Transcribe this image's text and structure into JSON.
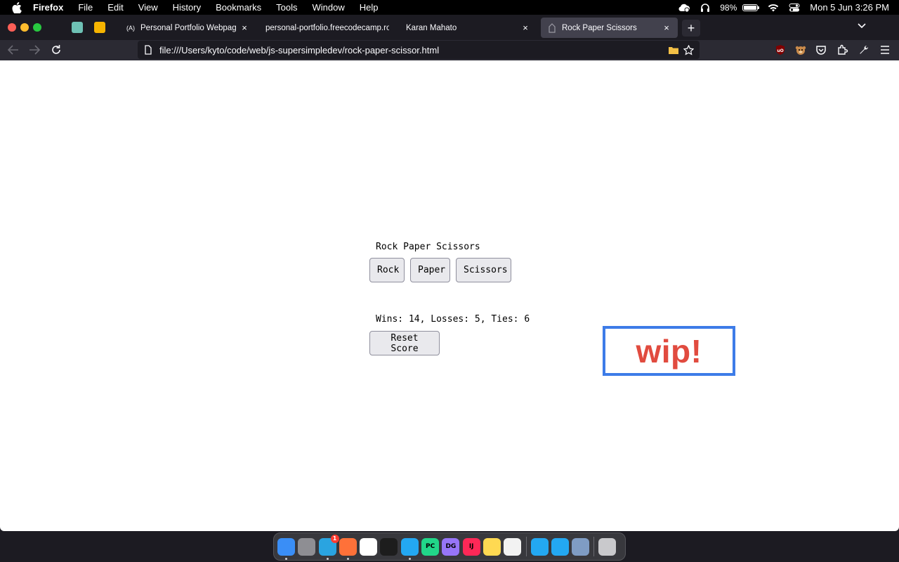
{
  "menubar": {
    "app_name": "Firefox",
    "menus": [
      "File",
      "Edit",
      "View",
      "History",
      "Bookmarks",
      "Tools",
      "Window",
      "Help"
    ],
    "battery_percent": "98%",
    "battery_level": 0.98,
    "clock": "Mon 5 Jun  3:26 PM"
  },
  "tabs": [
    {
      "title": "Personal Portfolio Webpage: Bu",
      "favicon": "(A)",
      "active": false
    },
    {
      "title": "personal-portfolio.freecodecamp.ro",
      "favicon": "",
      "active": false
    },
    {
      "title": "Karan Mahato",
      "favicon": "",
      "active": false
    },
    {
      "title": "Rock Paper Scissors",
      "favicon": "",
      "active": true
    }
  ],
  "tab_close": "×",
  "newtab_label": "+",
  "navbar": {
    "url": "file:///Users/kyto/code/web/js-supersimpledev/rock-paper-scissor.html"
  },
  "game": {
    "title": "Rock Paper Scissors",
    "moves": [
      "Rock",
      "Paper",
      "Scissors"
    ],
    "score_text": "Wins: 14, Losses: 5, Ties: 6",
    "reset_label": "Reset Score"
  },
  "overlay": {
    "label": "wip!",
    "border_color": "#3d7ce8",
    "text_color": "#e14b3f"
  },
  "dock": {
    "apps": [
      {
        "name": "finder",
        "color": "#3a8ef6"
      },
      {
        "name": "launchpad",
        "color": "#8e8e93"
      },
      {
        "name": "telegram",
        "color": "#2aa4e0",
        "badge": "1"
      },
      {
        "name": "firefox",
        "color": "#ff7139"
      },
      {
        "name": "chrome",
        "color": "#ffffff"
      },
      {
        "name": "terminal",
        "color": "#1d1d1d"
      },
      {
        "name": "vscode",
        "color": "#23a8f2"
      },
      {
        "name": "pycharm",
        "color": "#21d789",
        "label": "PC"
      },
      {
        "name": "datagrip",
        "color": "#9775f8",
        "label": "DG"
      },
      {
        "name": "intellij",
        "color": "#fe2857",
        "label": "IJ"
      },
      {
        "name": "notes",
        "color": "#ffd952"
      },
      {
        "name": "textedit",
        "color": "#f2f2f2"
      }
    ],
    "apps_right": [
      {
        "name": "vscode-window-1",
        "color": "#23a8f2"
      },
      {
        "name": "vscode-window-2",
        "color": "#23a8f2"
      },
      {
        "name": "preview-window",
        "color": "#7f9cc4"
      }
    ],
    "trash": {
      "name": "trash",
      "color": "#c9c9cc"
    }
  }
}
